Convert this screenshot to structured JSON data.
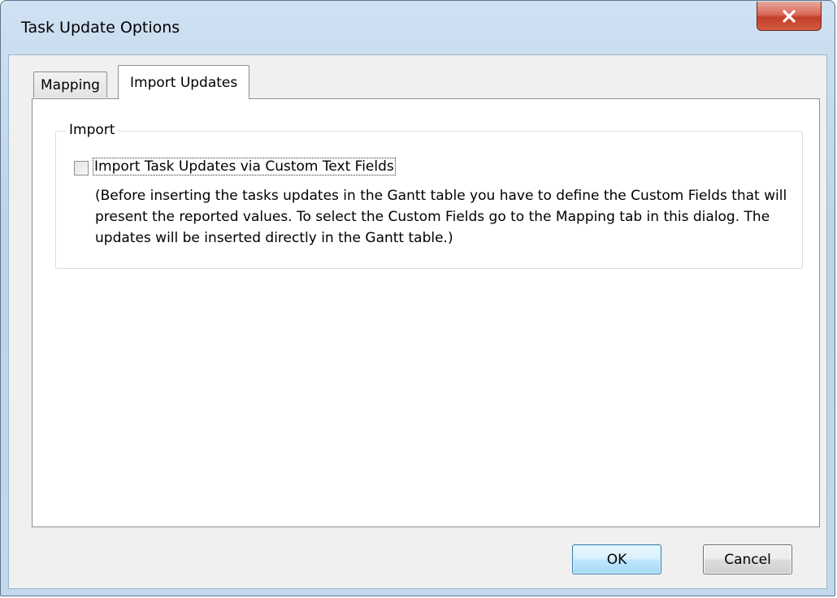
{
  "window": {
    "title": "Task Update Options"
  },
  "tabs": [
    {
      "label": "Mapping",
      "selected": false
    },
    {
      "label": "Import Updates",
      "selected": true
    }
  ],
  "import_group": {
    "legend": "Import",
    "checkbox_label": "Import Task Updates via Custom Text Fields",
    "checkbox_checked": false,
    "description": "(Before inserting the tasks updates in the Gantt table you have to define the Custom Fields that will present the reported values. To select the Custom Fields go to the Mapping tab in this dialog. The updates will be inserted directly in the Gantt table.)"
  },
  "buttons": {
    "ok": "OK",
    "cancel": "Cancel"
  },
  "icons": {
    "close": "close-icon"
  },
  "colors": {
    "close_button": "#c94f38",
    "ok_button_border": "#3c7fb1",
    "client_bg": "#f0f0f0"
  }
}
